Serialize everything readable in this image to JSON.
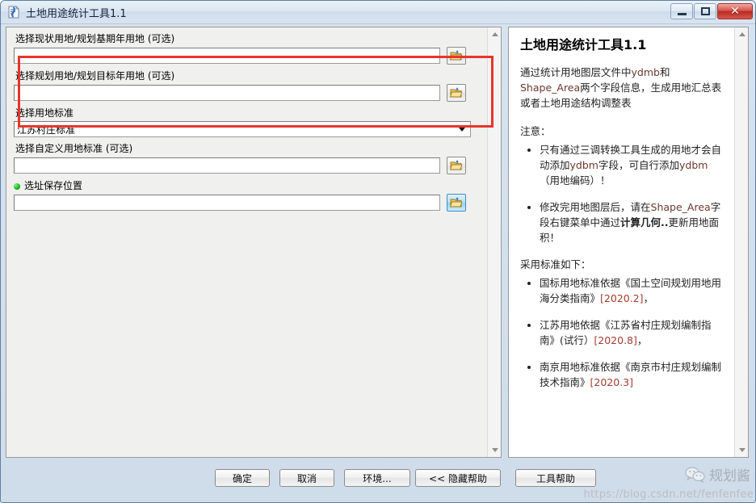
{
  "window": {
    "title": "土地用途统计工具1.1",
    "icon": "script-tool-icon",
    "minimize_label": "最小化",
    "maximize_label": "最大化",
    "close_label": "关闭"
  },
  "form": {
    "fields": [
      {
        "label": "选择现状用地/规划基期年用地  (可选)",
        "value": "",
        "control": "combobox",
        "browse": "folder-open-icon"
      },
      {
        "label": "选择规划用地/规划目标年用地  (可选)",
        "value": "",
        "control": "combobox",
        "browse": "folder-open-icon"
      },
      {
        "label": "选择用地标准",
        "value": "江苏村庄标准",
        "control": "dropdown",
        "browse": null
      },
      {
        "label": "选择自定义用地标准  (可选)",
        "value": "",
        "control": "textbox",
        "browse": "folder-open-icon"
      },
      {
        "label": "选址保存位置",
        "value": "",
        "control": "textbox",
        "browse": "folder-open-icon",
        "required_dot": true
      }
    ],
    "annotation_color": "#e8352b"
  },
  "help": {
    "title": "土地用途统计工具1.1",
    "intro_parts": {
      "a": "通过统计用地图层文件中",
      "b": "ydmb",
      "c": "和",
      "d": "Shape_Area",
      "e": "两个字段信息，生成用地汇总表或者土地用途结构调整表"
    },
    "notes_heading": "注意：",
    "notes": [
      {
        "p1": "只有通过三调转换工具生成的用地才会自动添加",
        "p2": "ydbm",
        "p3": "字段，可自行添加",
        "p4": "ydbm",
        "p5": "（用地编码）！"
      },
      {
        "p1": "修改完用地图层后，请在",
        "p2": "Shape_Area",
        "p3": "字段右键菜单中通过",
        "p4": "计算几何..",
        "p5": "更新用地面积！"
      }
    ],
    "standards_heading": "采用标准如下：",
    "standards": [
      {
        "text": "国标用地标准依据《国土空间规划用地用海分类指南》",
        "ref": "[2020.2]",
        "tail": "，"
      },
      {
        "text": "江苏用地依据《江苏省村庄规划编制指南》(试行）",
        "ref": "[2020.8]",
        "tail": "，"
      },
      {
        "text": "南京用地标准依据《南京市村庄规划编制技术指南》",
        "ref": "[2020.3]",
        "tail": ""
      }
    ]
  },
  "footer": {
    "buttons": [
      {
        "id": "btn-ok",
        "label": "确定"
      },
      {
        "id": "btn-cancel",
        "label": "取消"
      },
      {
        "id": "btn-env",
        "label": "环境..."
      },
      {
        "id": "btn-hide",
        "label": "<< 隐藏帮助"
      },
      {
        "id": "btn-help",
        "label": "工具帮助"
      }
    ]
  },
  "watermark": {
    "brand": "规划酱",
    "logo": "wechat-icon",
    "url": "https://blog.csdn.net/fenfenfee"
  }
}
